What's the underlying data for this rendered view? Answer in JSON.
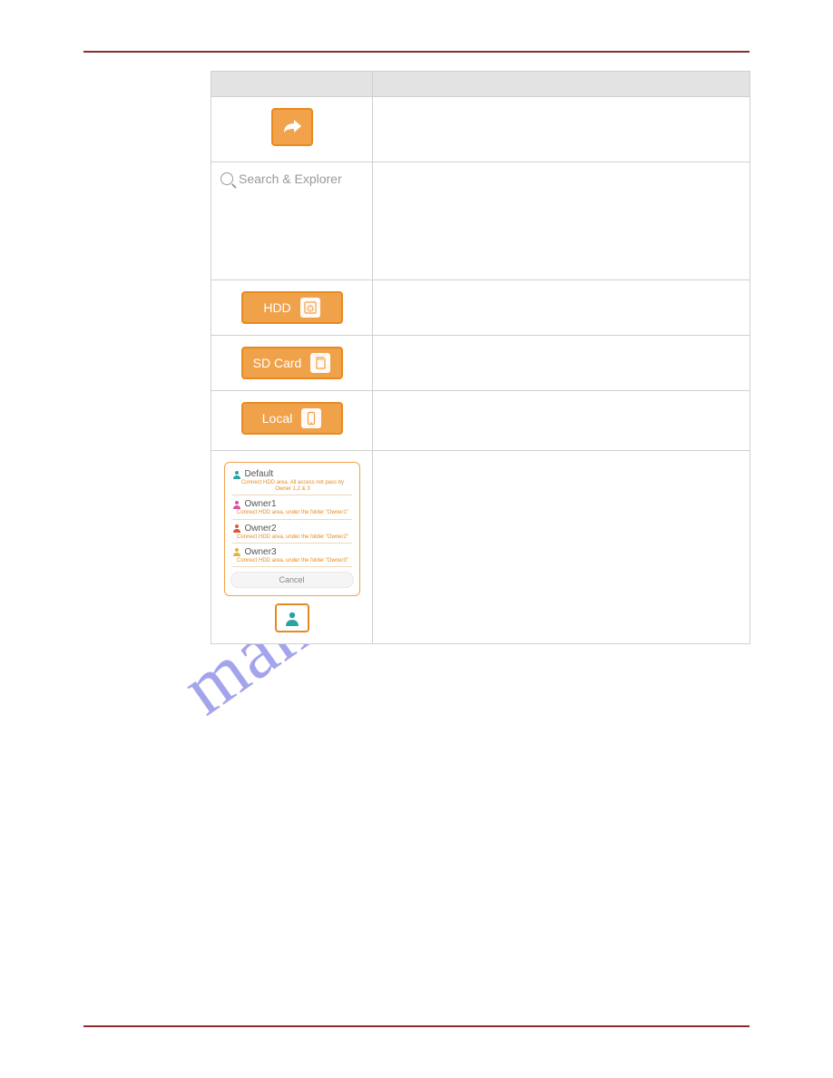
{
  "watermark": "manualshive.com",
  "table": {
    "rows": {
      "share": {
        "desc": ""
      },
      "search": {
        "placeholder": "Search & Explorer",
        "desc": ""
      },
      "hdd": {
        "label": "HDD",
        "desc": ""
      },
      "sd": {
        "label": "SD Card",
        "desc": ""
      },
      "local": {
        "label": "Local",
        "desc": ""
      },
      "owners": {
        "items": [
          {
            "name": "Default",
            "sub": "Connect HDD area. All access not pass by Owner 1,2 & 3"
          },
          {
            "name": "Owner1",
            "sub": "Connect HDD area, under the folder \"Owner1\""
          },
          {
            "name": "Owner2",
            "sub": "Connect HDD area, under the folder \"Owner2\""
          },
          {
            "name": "Owner3",
            "sub": "Connect HDD area, under the folder \"Owner3\""
          }
        ],
        "cancel": "Cancel",
        "desc": ""
      }
    }
  }
}
